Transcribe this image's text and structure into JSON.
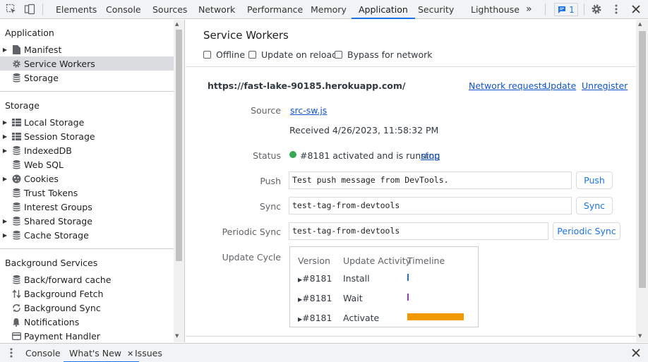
{
  "toolbar": {
    "tabs": [
      "Elements",
      "Console",
      "Sources",
      "Network",
      "Performance",
      "Memory",
      "Application",
      "Security",
      "Lighthouse"
    ],
    "active_tab": "Application",
    "more_tabs": "»",
    "issues_count": "1"
  },
  "sidebar": {
    "application": {
      "title": "Application",
      "items": [
        "Manifest",
        "Service Workers",
        "Storage"
      ]
    },
    "storage": {
      "title": "Storage",
      "items": [
        "Local Storage",
        "Session Storage",
        "IndexedDB",
        "Web SQL",
        "Cookies",
        "Trust Tokens",
        "Interest Groups",
        "Shared Storage",
        "Cache Storage"
      ]
    },
    "background": {
      "title": "Background Services",
      "items": [
        "Back/forward cache",
        "Background Fetch",
        "Background Sync",
        "Notifications",
        "Payment Handler"
      ]
    }
  },
  "main": {
    "title": "Service Workers",
    "options": [
      "Offline",
      "Update on reload",
      "Bypass for network"
    ],
    "origin": "https://fast-lake-90185.herokuapp.com/",
    "origin_links": [
      "Network requests",
      "Update",
      "Unregister"
    ],
    "source_label": "Source",
    "source_link": "src-sw.js",
    "received": "Received 4/26/2023, 11:58:32 PM",
    "status_label": "Status",
    "status_text": "#8181 activated and is running",
    "status_link": "stop",
    "push_label": "Push",
    "push_value": "Test push message from DevTools.",
    "push_button": "Push",
    "sync_label": "Sync",
    "sync_value": "test-tag-from-devtools",
    "sync_button": "Sync",
    "periodic_label": "Periodic Sync",
    "periodic_value": "test-tag-from-devtools",
    "periodic_button": "Periodic Sync",
    "update_cycle_label": "Update Cycle",
    "update_cycle": {
      "headers": [
        "Version",
        "Update Activity",
        "Timeline"
      ],
      "rows": [
        {
          "version": "#8181",
          "activity": "Install",
          "color": "#1a73e8"
        },
        {
          "version": "#8181",
          "activity": "Wait",
          "color": "#9334e6"
        },
        {
          "version": "#8181",
          "activity": "Activate",
          "color": "#f29900"
        }
      ]
    }
  },
  "drawer": {
    "tabs": [
      "Console",
      "What's New",
      "Issues"
    ],
    "active_tab": "What's New"
  }
}
